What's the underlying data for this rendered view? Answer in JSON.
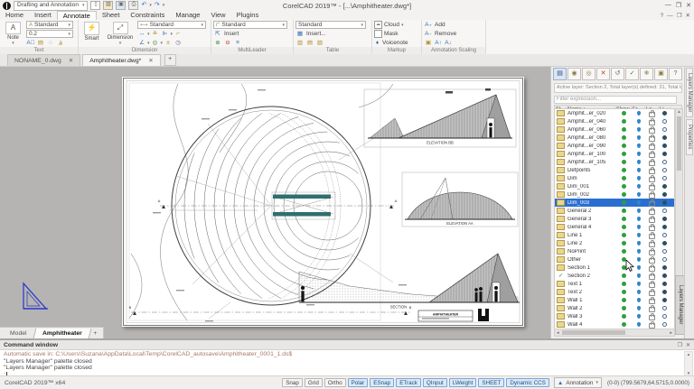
{
  "window": {
    "title": "CorelCAD 2019™  -  [...\\Amphitheater.dwg*]",
    "workspace": "Drafting and Annotation",
    "version": "CorelCAD 2019™ x64"
  },
  "menu": {
    "tabs": [
      "Home",
      "Insert",
      "Annotate",
      "Sheet",
      "Constraints",
      "Manage",
      "View",
      "Plugins"
    ],
    "active": "Annotate"
  },
  "ribbon": {
    "text": {
      "label": "Text",
      "note": "Note",
      "style": "Standard",
      "height": "0.2"
    },
    "dimension": {
      "label": "Dimension",
      "smart": "Smart",
      "dim": "Dimension",
      "style": "Standard"
    },
    "multileader": {
      "label": "MultiLeader",
      "style": "Standard",
      "insert": "Insert"
    },
    "table": {
      "label": "Table",
      "style": "Standard",
      "insert": "Insert..."
    },
    "markup": {
      "label": "Markup",
      "cloud": "Cloud",
      "mask": "Mask",
      "voicenote": "Voicenote"
    },
    "annotation_scaling": {
      "label": "Annotation Scaling",
      "add": "Add",
      "remove": "Remove"
    }
  },
  "document_tabs": [
    {
      "label": "NONAME_0.dwg",
      "active": false
    },
    {
      "label": "Amphitheater.dwg*",
      "active": true
    }
  ],
  "sheet_tabs": {
    "tabs": [
      "Model",
      "Amphitheater"
    ],
    "active": "Amphitheater"
  },
  "drawing": {
    "elevation_bb": "ELEVATION BB",
    "elevation_aa": "ELEVATION AA",
    "section": "SECTION",
    "title_block": "AMPHITHEATER"
  },
  "layers_panel": {
    "title": "Layers Manager",
    "side_tabs": [
      "Layers Manager",
      "Properties"
    ],
    "info": "Active layer: Section 2, Total layer(s) defined: 31, Total lay...",
    "filter_placeholder": "Filter expression...",
    "columns": [
      "St...",
      "Name ▴",
      "Show",
      "Fr...",
      "Lo...",
      "Li..."
    ],
    "rows": [
      {
        "name": "Amphit...er_020",
        "dot": true
      },
      {
        "name": "Amphit...er_040",
        "dot": false
      },
      {
        "name": "Amphit...er_060",
        "dot": false
      },
      {
        "name": "Amphit...er_080",
        "dot": true
      },
      {
        "name": "Amphit...er_090",
        "dot": true
      },
      {
        "name": "Amphit...er_100",
        "dot": true
      },
      {
        "name": "Amphit...er_105",
        "dot": false
      },
      {
        "name": "Defpoints",
        "dot": false
      },
      {
        "name": "Dim",
        "dot": false
      },
      {
        "name": "Dim_001",
        "dot": true
      },
      {
        "name": "Dim_002",
        "dot": true
      },
      {
        "name": "Dim_003",
        "dot": true,
        "selected": true
      },
      {
        "name": "General 2",
        "dot": false
      },
      {
        "name": "General 3",
        "dot": true
      },
      {
        "name": "General 4",
        "dot": true
      },
      {
        "name": "Line 1",
        "dot": false
      },
      {
        "name": "Line 2",
        "dot": true
      },
      {
        "name": "NoPrint",
        "dot": false
      },
      {
        "name": "Other",
        "dot": false
      },
      {
        "name": "Section 1",
        "dot": true
      },
      {
        "name": "Section 2",
        "dot": true,
        "active": true
      },
      {
        "name": "Text 1",
        "dot": true
      },
      {
        "name": "Text 2",
        "dot": true
      },
      {
        "name": "Wall 1",
        "dot": true
      },
      {
        "name": "Wall 2",
        "dot": false
      },
      {
        "name": "Wall 3",
        "dot": false
      },
      {
        "name": "Wall 4",
        "dot": false
      }
    ]
  },
  "command_window": {
    "title": "Command window",
    "autosave_line": "Automatic save in: C:\\Users\\Suzana\\AppData\\Local\\Temp\\CorelCAD_autosave\\Amphitheater_0001_1.ds$",
    "lines": [
      "\"Layers Manager\" palette closed",
      "\"Layers Manager\" palette closed"
    ],
    "prompt": ":"
  },
  "status_bar": {
    "app": "CorelCAD 2019™ x64",
    "toggles": [
      {
        "label": "Snap",
        "on": false
      },
      {
        "label": "Grid",
        "on": false
      },
      {
        "label": "Ortho",
        "on": false
      },
      {
        "label": "Polar",
        "on": true
      },
      {
        "label": "ESnap",
        "on": true
      },
      {
        "label": "ETrack",
        "on": true
      },
      {
        "label": "QInput",
        "on": true
      },
      {
        "label": "LWeight",
        "on": true
      },
      {
        "label": "SHEET",
        "on": true
      },
      {
        "label": "Dynamic CCS",
        "on": true
      }
    ],
    "annotation": "Annotation",
    "coords": "(0-0)  (799.5679,64.5715,0.0000)"
  },
  "colors": {
    "selection": "#2a6fd0",
    "toggle_on": "#dce9f7",
    "stage": "#2f6f6f",
    "canvas": "#b5b4b2"
  }
}
